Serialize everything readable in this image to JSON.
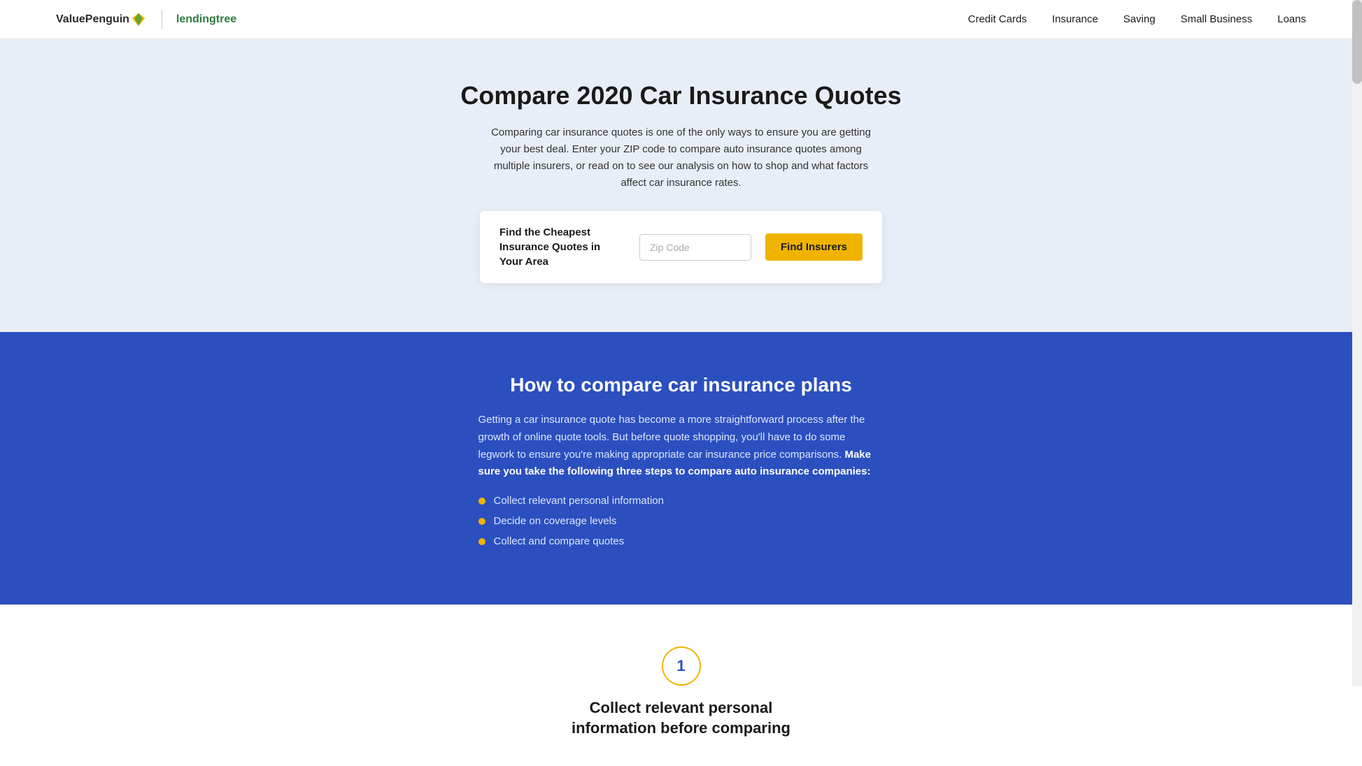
{
  "header": {
    "logo_vp": "ValuePenguin",
    "logo_lt": "lendingtree",
    "nav_items": [
      {
        "label": "Credit Cards",
        "id": "credit-cards"
      },
      {
        "label": "Insurance",
        "id": "insurance"
      },
      {
        "label": "Saving",
        "id": "saving"
      },
      {
        "label": "Small Business",
        "id": "small-business"
      },
      {
        "label": "Loans",
        "id": "loans"
      }
    ]
  },
  "hero": {
    "title": "Compare 2020 Car Insurance Quotes",
    "description": "Comparing car insurance quotes is one of the only ways to ensure you are getting your best deal. Enter your ZIP code to compare auto insurance quotes among multiple insurers, or read on to see our analysis on how to shop and what factors affect car insurance rates.",
    "quote_label": "Find the Cheapest Insurance Quotes in Your Area",
    "zip_placeholder": "Zip Code",
    "find_button": "Find Insurers"
  },
  "blue_section": {
    "title": "How to compare car insurance plans",
    "description_part1": "Getting a car insurance quote has become a more straightforward process after the growth of online quote tools. But before quote shopping, you'll have to do some legwork to ensure you're making appropriate car insurance price comparisons. ",
    "description_bold": "Make sure you take the following three steps to compare auto insurance companies:",
    "bullets": [
      "Collect relevant personal information",
      "Decide on coverage levels",
      "Collect and compare quotes"
    ]
  },
  "step_section": {
    "step_number": "1",
    "step_title_line1": "Collect relevant personal",
    "step_title_line2": "information before comparing"
  }
}
